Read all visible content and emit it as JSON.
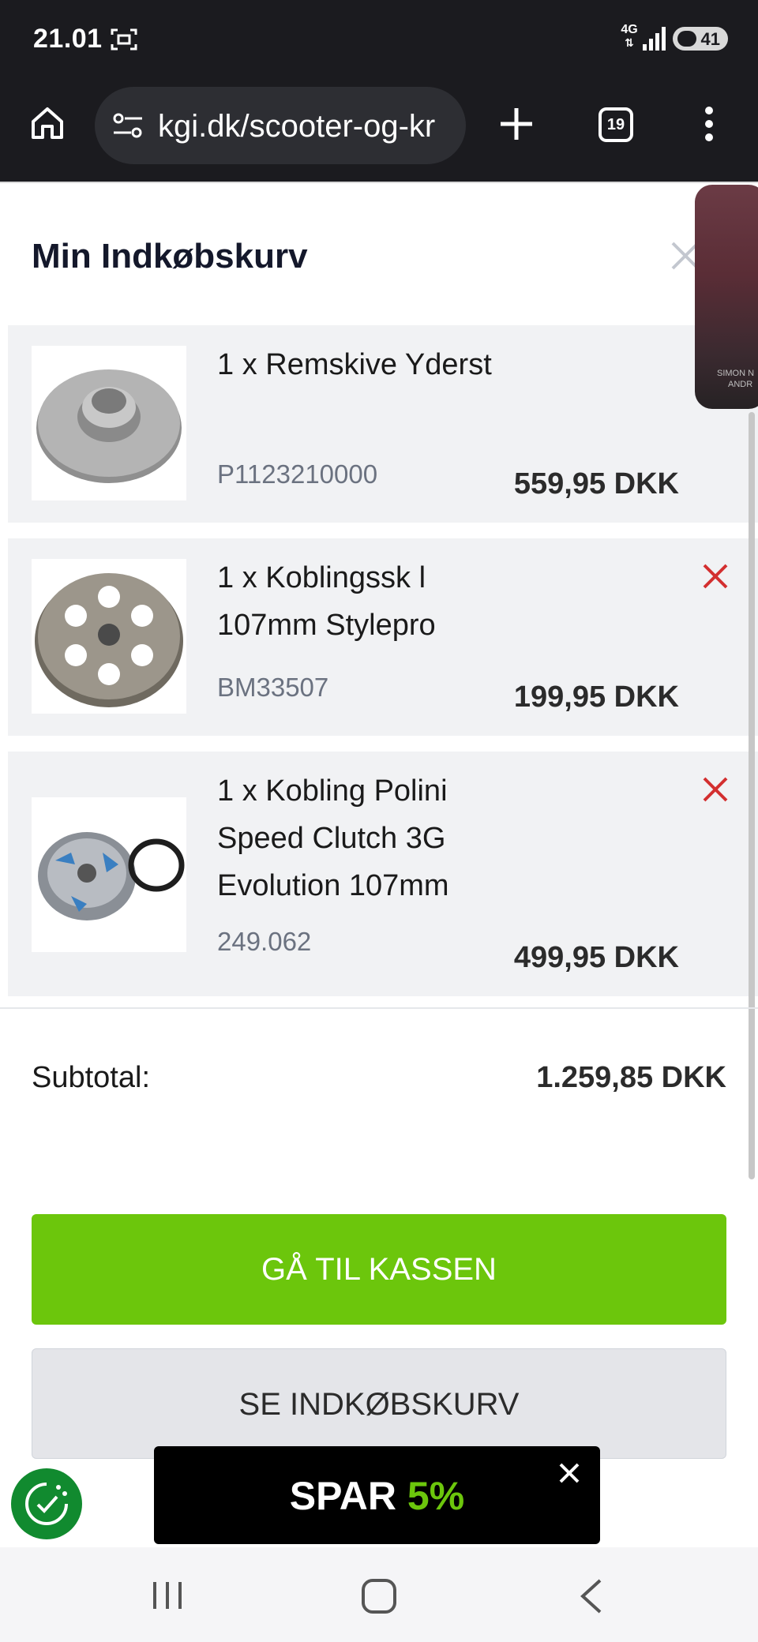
{
  "status_bar": {
    "time": "21.01",
    "network": "4G",
    "battery": "41"
  },
  "browser": {
    "url": "kgi.dk/scooter-og-kr",
    "tab_count": "19"
  },
  "cart": {
    "title": "Min Indkøbskurv",
    "items": [
      {
        "name": "1 x Remskive Yderst",
        "sku": "P1123210000",
        "price": "559,95 DKK",
        "image": "pulley-image"
      },
      {
        "name": "1 x Koblingssk l 107mm Stylepro",
        "sku": "BM33507",
        "price": "199,95 DKK",
        "image": "clutch-bell-image"
      },
      {
        "name": "1 x Kobling Polini Speed Clutch 3G Evolution 107mm",
        "sku": "249.062",
        "price": "499,95 DKK",
        "image": "clutch-assembly-image"
      }
    ],
    "subtotal_label": "Subtotal:",
    "subtotal_value": "1.259,85 DKK",
    "checkout_label": "GÅ TIL KASSEN",
    "view_cart_label": "SE INDKØBSKURV"
  },
  "promo_thumb": {
    "caption_line1": "SIMON N",
    "caption_line2": "ANDR"
  },
  "spar_banner": {
    "word": "SPAR",
    "percent": "5%"
  },
  "colors": {
    "accent_green": "#6cc60c",
    "remove_red": "#d32f2f",
    "dark_bar": "#1b1b1f"
  }
}
